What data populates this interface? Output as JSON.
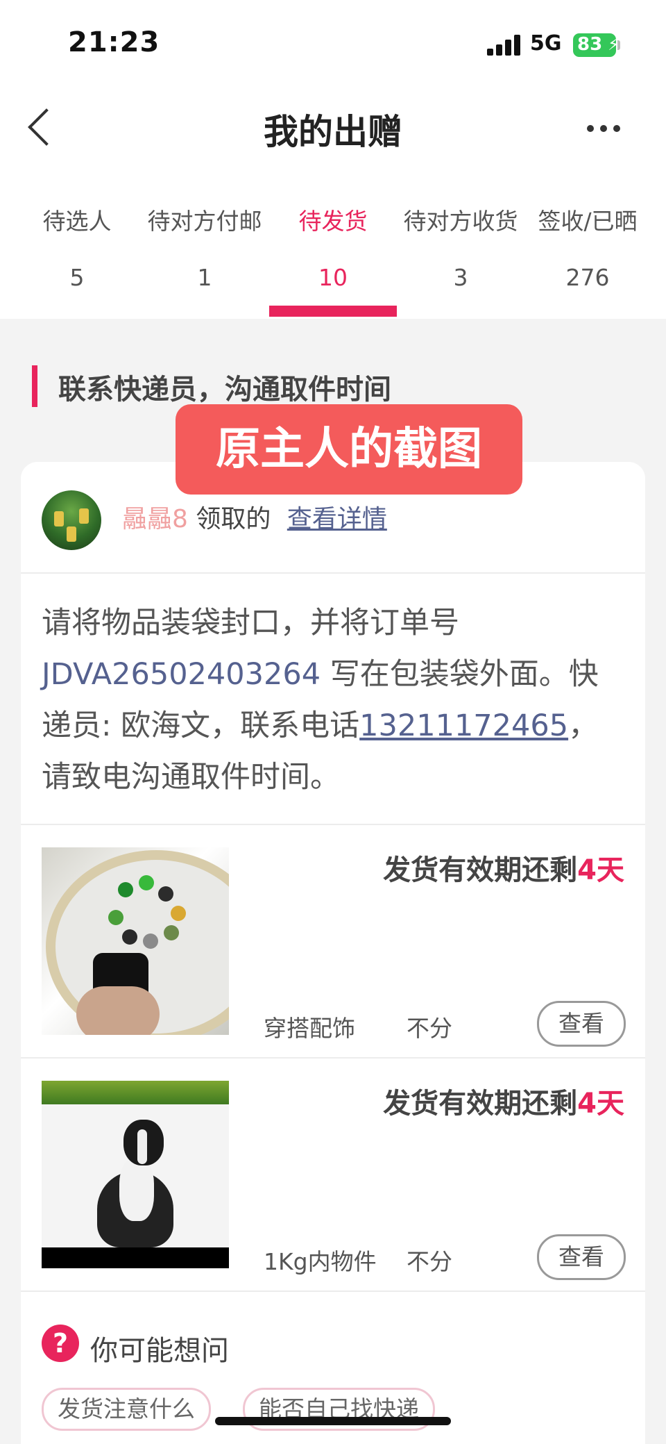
{
  "status_bar": {
    "time": "21:23",
    "network": "5G",
    "battery": "83"
  },
  "header": {
    "title": "我的出赠"
  },
  "tabs": [
    {
      "label": "待选人",
      "count": "5"
    },
    {
      "label": "待对方付邮",
      "count": "1"
    },
    {
      "label": "待发货",
      "count": "10"
    },
    {
      "label": "待对方收货",
      "count": "3"
    },
    {
      "label": "签收/已晒",
      "count": "276"
    }
  ],
  "section": {
    "title": "联系快递员，沟通取件时间"
  },
  "overlay": {
    "text": "原主人的截图"
  },
  "user": {
    "name": "曧曧8",
    "action": "领取的",
    "link": "查看详情"
  },
  "notice": {
    "part1": "请将物品装袋封口，并将订单号 ",
    "order_no": "JDVA26502403264",
    "part2": " 写在包装袋外面。快递员: 欧海文，联系电话",
    "phone": "13211172465",
    "part3": "，请致电沟通取件时间。"
  },
  "items": [
    {
      "expiry_prefix": "发货有效期还剩",
      "expiry_days": "4天",
      "category": "穿搭配饰",
      "mode": "不分",
      "button": "查看"
    },
    {
      "expiry_prefix": "发货有效期还剩",
      "expiry_days": "4天",
      "category": "1Kg内物件",
      "mode": "不分",
      "button": "查看"
    }
  ],
  "faq": {
    "title": "你可能想问",
    "chips": [
      "发货注意什么",
      "能否自己找快递"
    ]
  },
  "colors": {
    "accent": "#e8245c",
    "link": "#55618f",
    "overlay": "#f45b5b",
    "battery": "#34c759"
  }
}
